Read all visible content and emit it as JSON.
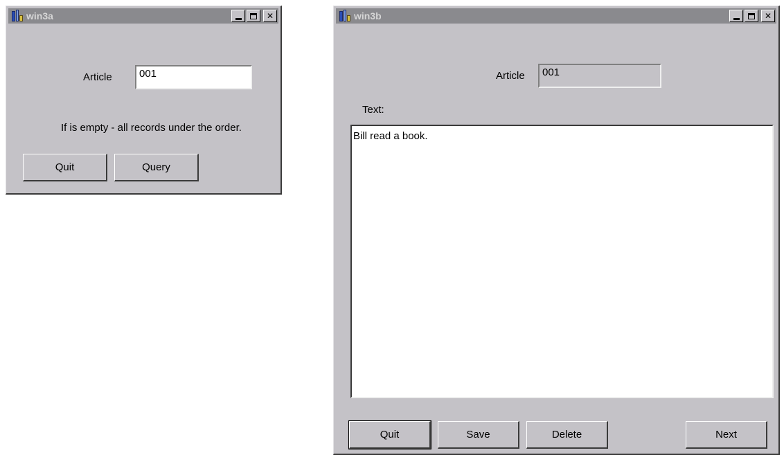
{
  "win3a": {
    "title": "win3a",
    "article_label": "Article",
    "article_value": "001",
    "hint": "If is empty - all records under the order.",
    "quit_label": "Quit",
    "query_label": "Query"
  },
  "win3b": {
    "title": "win3b",
    "article_label": "Article",
    "article_value": "001",
    "text_label": "Text:",
    "text_value": "Bill read a book.",
    "quit_label": "Quit",
    "save_label": "Save",
    "delete_label": "Delete",
    "next_label": "Next"
  },
  "icons": [
    "app-icon",
    "minimize-icon",
    "maximize-icon",
    "close-icon"
  ],
  "colors": {
    "window_bg": "#c4c2c7",
    "titlebar_inactive": "#8a8a8e"
  }
}
